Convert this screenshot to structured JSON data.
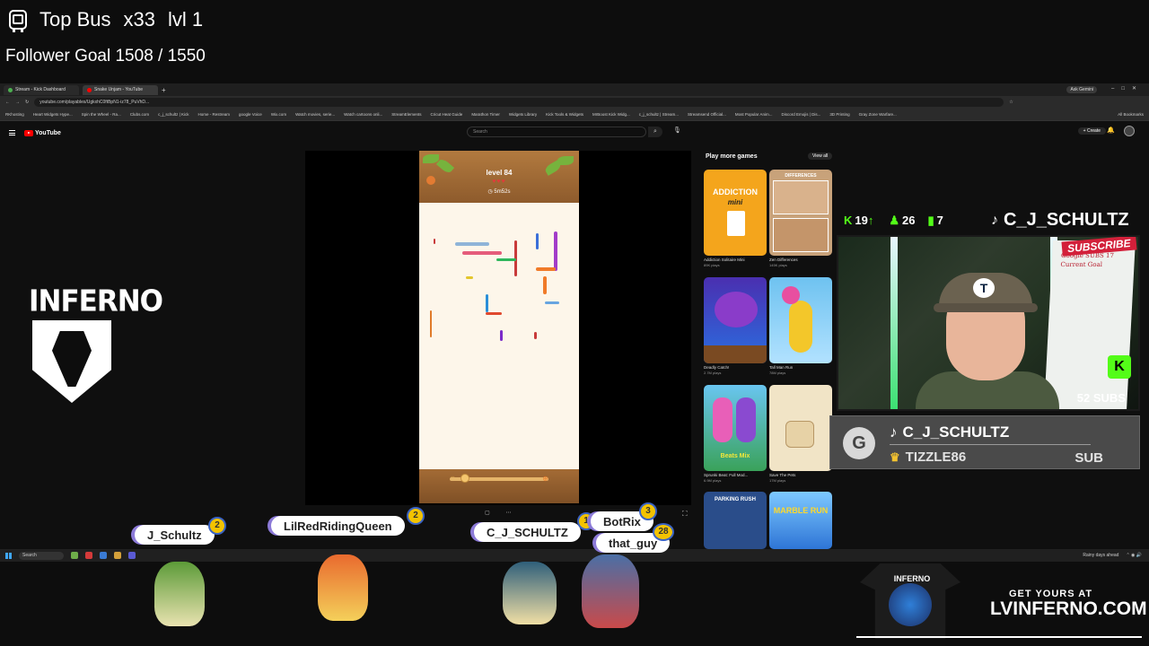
{
  "overlay": {
    "top_bus_label": "Top Bus",
    "top_bus_multiplier": "x33",
    "top_bus_level": "lvl 1",
    "follower_goal": "Follower Goal 1508 / 1550"
  },
  "browser": {
    "tabs": [
      {
        "label": "Stream - Kick Dashboard"
      },
      {
        "label": "Snake Unjam - YouTube"
      }
    ],
    "ask_gemini": "Ask Gemini",
    "url": "youtube.com/playables/UgkxhC0ftBpN1-iz78_PuVhD...",
    "bookmarks": [
      "RKhosting",
      "Heart Widgets Hype...",
      "Spin the Wheel - Ra...",
      "Clubs.com",
      "c_j_schultz | Kick",
      "Home - Restream",
      "google Voice",
      "Wix.com",
      "Watch movies, serie...",
      "Watch cartoons onli...",
      "StreamElements",
      "Cricut Heat Guide",
      "Marathon Timer",
      "Widgets Library",
      "Kick Tools & Widgets",
      "MrBoost Kick Widg...",
      "c_j_schultz | Stream...",
      "Streamsend Official...",
      "Most Popular Anim...",
      "Discord Emojis | Dis...",
      "3D Printing",
      "Gray Zone Warfare..."
    ],
    "all_bookmarks": "All Bookmarks"
  },
  "youtube": {
    "logo": "YouTube",
    "search_placeholder": "Search",
    "create_label": "+ Create"
  },
  "game": {
    "level": "level 84",
    "hearts": "♥♥♥",
    "timer": "◷ 5m52s"
  },
  "play_more_games": {
    "title": "Play more games",
    "view_all": "View all",
    "tiles": [
      {
        "title": "Addiction Solitaire Mini",
        "plays": "89K plays",
        "art_text": "ADDICTION",
        "art_sub": "mini"
      },
      {
        "title": "Zen Differences",
        "plays": "145K plays",
        "art_text": "DIFFERENCES",
        "art_sub": ""
      },
      {
        "title": "Deadly Catch!",
        "plays": "2.7M plays",
        "art_text": "",
        "art_sub": ""
      },
      {
        "title": "Tall Man Run",
        "plays": "78M plays",
        "art_text": "",
        "art_sub": ""
      },
      {
        "title": "Sprunki Beat: Full Mod...",
        "plays": "6.9M plays",
        "art_text": "Beats Mix",
        "art_sub": ""
      },
      {
        "title": "Save The Pets",
        "plays": "17M plays",
        "art_text": "",
        "art_sub": ""
      },
      {
        "title": "",
        "plays": "",
        "art_text": "PARKING RUSH",
        "art_sub": ""
      },
      {
        "title": "",
        "plays": "",
        "art_text": "MARBLE RUN",
        "art_sub": ""
      }
    ]
  },
  "stream_stats": {
    "kick_followers": "19",
    "followers": "26",
    "viewers": "7"
  },
  "channel_name": "C_J_SCHULTZ",
  "webcam": {
    "subscribe_banner": "SUBSCRIBE",
    "board_text": "Google SUBS 17\nCurrent Goal",
    "subs_count": "52 SUBS"
  },
  "sub_alert": {
    "name": "C_J_SCHULTZ",
    "user": "TIZZLE86",
    "label": "SUB"
  },
  "taskbar": {
    "search": "Search",
    "weather": "Rainy days ahead"
  },
  "logo": {
    "text": "INFERNO"
  },
  "chat_tags": [
    {
      "name": "J_Schultz",
      "badge": "2"
    },
    {
      "name": "LilRedRidingQueen",
      "badge": "2"
    },
    {
      "name": "C_J_SCHULTZ",
      "badge": "1"
    },
    {
      "name": "BotRix",
      "badge": "3"
    },
    {
      "name": "that_guy",
      "badge": "28"
    }
  ],
  "merch": {
    "shirt_text": "INFERNO",
    "get_yours": "GET YOURS AT",
    "url": "LVINFERNO.COM"
  },
  "colors": {
    "kick_green": "#53fc18",
    "youtube_red": "#ff0000",
    "badge_gold": "#f3c300"
  }
}
